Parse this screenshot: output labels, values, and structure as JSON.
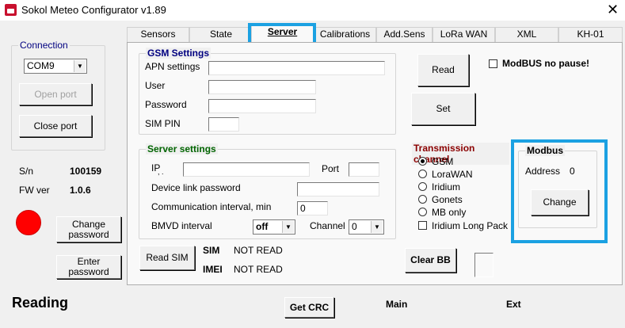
{
  "window": {
    "title": "Sokol Meteo Configurator v1.89",
    "close_glyph": "✕",
    "icon": "app-icon"
  },
  "connection": {
    "title": "Connection",
    "port": "COM9",
    "open_port": "Open port",
    "close_port": "Close port"
  },
  "device": {
    "sn_label": "S/n",
    "sn_value": "100159",
    "fw_label": "FW ver",
    "fw_value": "1.0.6",
    "status_color": "#ff0000"
  },
  "password": {
    "change": "Change password",
    "enter": "Enter password"
  },
  "status": {
    "reading": "Reading"
  },
  "tabs": [
    {
      "label": "Sensors"
    },
    {
      "label": "State"
    },
    {
      "label": "Server",
      "active": true
    },
    {
      "label": "Calibrations"
    },
    {
      "label": "Add.Sens"
    },
    {
      "label": "LoRa WAN"
    },
    {
      "label": "XML"
    },
    {
      "label": "KH-01"
    }
  ],
  "gsm": {
    "title": "GSM Settings",
    "apn_label": "APN settings",
    "apn_value": "",
    "user_label": "User",
    "user_value": "",
    "password_label": "Password",
    "password_value": "",
    "simpin_label": "SIM PIN",
    "simpin_value": ""
  },
  "actions": {
    "read": "Read",
    "set": "Set",
    "modbus_no_pause": "ModBUS no pause!"
  },
  "server": {
    "title": "Server settings",
    "ip_label": "IP",
    "ip_sub": ", .",
    "ip_value": "",
    "port_label": "Port",
    "port_value": "",
    "link_password_label": "Device link password",
    "link_password_value": "",
    "comm_interval_label": "Communication interval, min",
    "comm_interval_value": "0",
    "bmvd_label": "BMVD interval",
    "bmvd_value": "off",
    "channel_label": "Channel",
    "channel_value": "0"
  },
  "transmission": {
    "title": "Transmission channel",
    "options": [
      {
        "label": "GSM",
        "checked": true
      },
      {
        "label": "LoraWAN",
        "checked": false
      },
      {
        "label": "Iridium",
        "checked": false
      },
      {
        "label": "Gonets",
        "checked": false
      },
      {
        "label": "MB only",
        "checked": false
      }
    ],
    "iridium_long_pack": "Iridium Long Pack"
  },
  "modbus": {
    "title": "Modbus",
    "address_label": "Address",
    "address_value": "0",
    "change": "Change"
  },
  "sim": {
    "read_sim": "Read SIM",
    "sim_label": "SIM",
    "sim_value": "NOT READ",
    "imei_label": "IMEI",
    "imei_value": "NOT READ"
  },
  "clear_bb": "Clear BB",
  "bottom": {
    "get_crc": "Get CRC",
    "main": "Main",
    "ext": "Ext"
  },
  "colors": {
    "highlight": "#1ba1e2",
    "group_title_blue": "#000080",
    "group_title_green": "#006400",
    "group_title_red": "#8b0000"
  }
}
